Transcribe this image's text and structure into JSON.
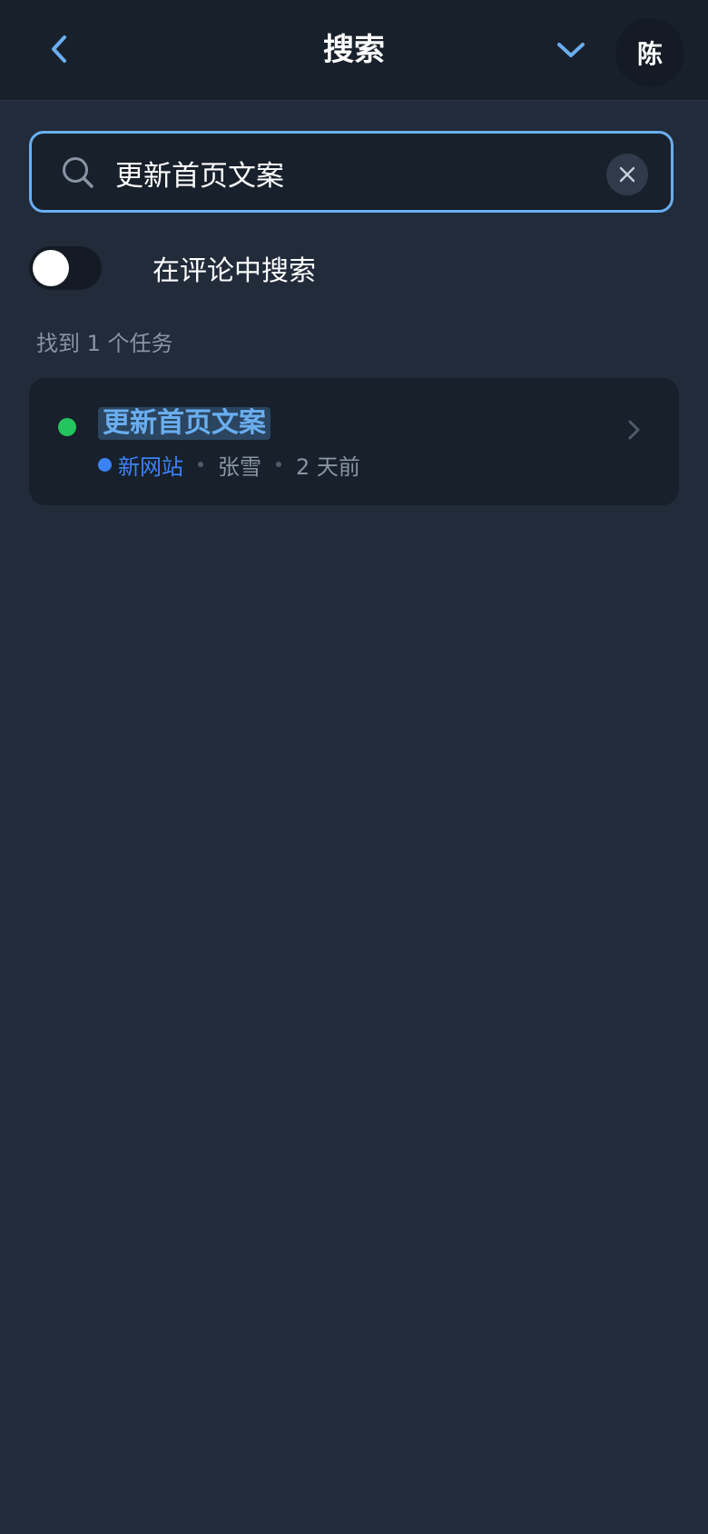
{
  "header": {
    "title": "搜索",
    "avatar_initial": "陈"
  },
  "search": {
    "value": "更新首页文案",
    "placeholder": ""
  },
  "comment_search": {
    "label": "在评论中搜索",
    "enabled": false
  },
  "results": {
    "count_text": "找到 1 个任务",
    "items": [
      {
        "title": "更新首页文案",
        "status_color": "#22c55e",
        "project": "新网站",
        "project_color": "#3b82f6",
        "assignee": "张雪",
        "time": "2 天前"
      }
    ]
  },
  "colors": {
    "background": "#212b3a",
    "header_bg": "#18202b",
    "accent": "#6aaef0",
    "muted_text": "#8894a4"
  },
  "icons": {
    "back": "chevron-left-icon",
    "collapse": "chevron-down-icon",
    "search": "search-icon",
    "clear": "close-icon",
    "open_item": "chevron-right-icon"
  }
}
